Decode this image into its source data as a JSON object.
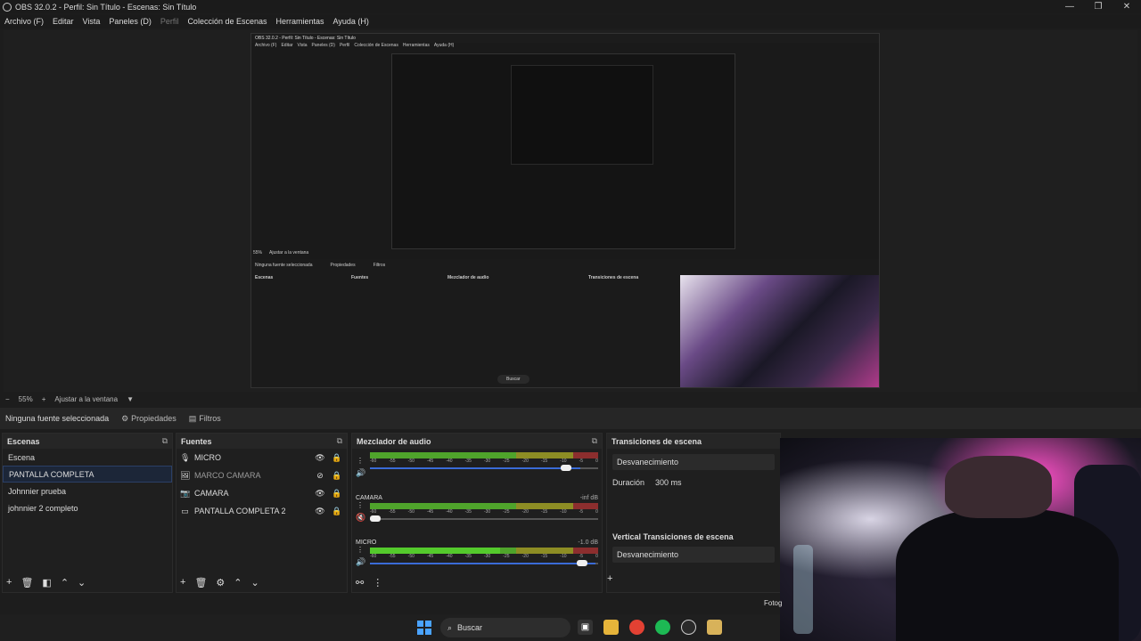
{
  "window": {
    "title": "OBS 32.0.2 - Perfil: Sin Título - Escenas: Sin Título",
    "minimize": "—",
    "maximize": "❐",
    "close": "✕"
  },
  "menu": {
    "items": [
      "Archivo (F)",
      "Editar",
      "Vista",
      "Paneles (D)",
      "Perfil",
      "Colección de Escenas",
      "Herramientas",
      "Ayuda (H)"
    ]
  },
  "preview": {
    "inner_title": "OBS 32.0.2 - Perfil: Sin Título - Escenas: Sin Título",
    "inner_menu": [
      "Archivo (F)",
      "Editar",
      "Vista",
      "Paneles (D)",
      "Perfil",
      "Colección de Escenas",
      "Herramientas",
      "Ayuda (H)"
    ],
    "inner_status": "Ninguna fuente seleccionada",
    "inner_props": "Propiedades",
    "inner_filters": "Filtros",
    "inner_zoom": "55%",
    "inner_fit": "Ajustar a la ventana",
    "inner_scenes_header": "Escenas",
    "inner_sources_header": "Fuentes",
    "inner_mixer_header": "Mezclador de audio",
    "inner_trans_header": "Transiciones de escena",
    "inner_search": "Buscar"
  },
  "zoom": {
    "minus": "−",
    "value": "55%",
    "plus": "+",
    "fit_label": "Ajustar a la ventana",
    "dropdown_icon": "chevron-down-icon"
  },
  "source_toolbar": {
    "status": "Ninguna fuente seleccionada",
    "properties": "Propiedades",
    "filters": "Filtros"
  },
  "scenes": {
    "header": "Escenas",
    "items": [
      {
        "label": "Escena"
      },
      {
        "label": "PANTALLA COMPLETA",
        "selected": true
      },
      {
        "label": "Johnnier prueba"
      },
      {
        "label": "johnnier 2 completo"
      }
    ]
  },
  "sources": {
    "header": "Fuentes",
    "items": [
      {
        "label": "MICRO",
        "icon": "microphone-icon",
        "visible": true
      },
      {
        "label": "MARCO CAMARA",
        "icon": "image-icon",
        "visible": false
      },
      {
        "label": "CAMARA",
        "icon": "camera-icon",
        "visible": true
      },
      {
        "label": "PANTALLA COMPLETA 2",
        "icon": "monitor-icon",
        "visible": true
      }
    ]
  },
  "mixer": {
    "header": "Mezclador de audio",
    "ticks": [
      "-60",
      "-55",
      "-50",
      "-45",
      "-40",
      "-35",
      "-30",
      "-25",
      "-20",
      "-15",
      "-10",
      "-5",
      "0"
    ],
    "channels": [
      {
        "name": "",
        "db": "",
        "level": 0.0,
        "volume": 0.92,
        "muted": false
      },
      {
        "name": "CAMARA",
        "db": "-inf dB",
        "level": 0.0,
        "volume": 0.02,
        "muted": true
      },
      {
        "name": "MICRO",
        "db": "-1.0 dB",
        "level": 0.57,
        "volume": 0.99,
        "muted": false
      }
    ]
  },
  "transitions": {
    "header": "Transiciones de escena",
    "type": "Desvanecimiento",
    "duration_label": "Duración",
    "duration_value": "300 ms",
    "vertical_header": "Vertical Transiciones de escena",
    "vertical_type": "Desvanecimiento",
    "add": "+"
  },
  "camera_overlay": {
    "label": "Fotog"
  },
  "taskbar": {
    "search_placeholder": "Buscar",
    "apps": [
      "file-explorer-icon",
      "chrome-icon",
      "spotify-icon",
      "obs-icon",
      "app-icon"
    ]
  }
}
